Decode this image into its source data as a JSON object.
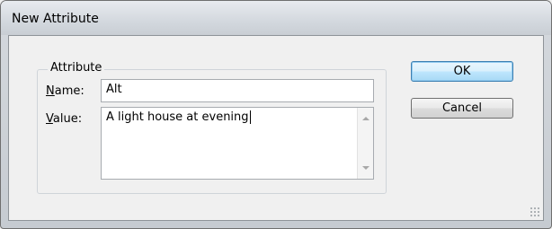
{
  "window": {
    "title": "New Attribute"
  },
  "group": {
    "legend": "Attribute"
  },
  "name_field": {
    "label_mnemonic": "N",
    "label_rest": "ame:",
    "value": "Alt"
  },
  "value_field": {
    "label_mnemonic": "V",
    "label_rest": "alue:",
    "value": "A light house at evening"
  },
  "buttons": {
    "ok": "OK",
    "cancel": "Cancel"
  }
}
